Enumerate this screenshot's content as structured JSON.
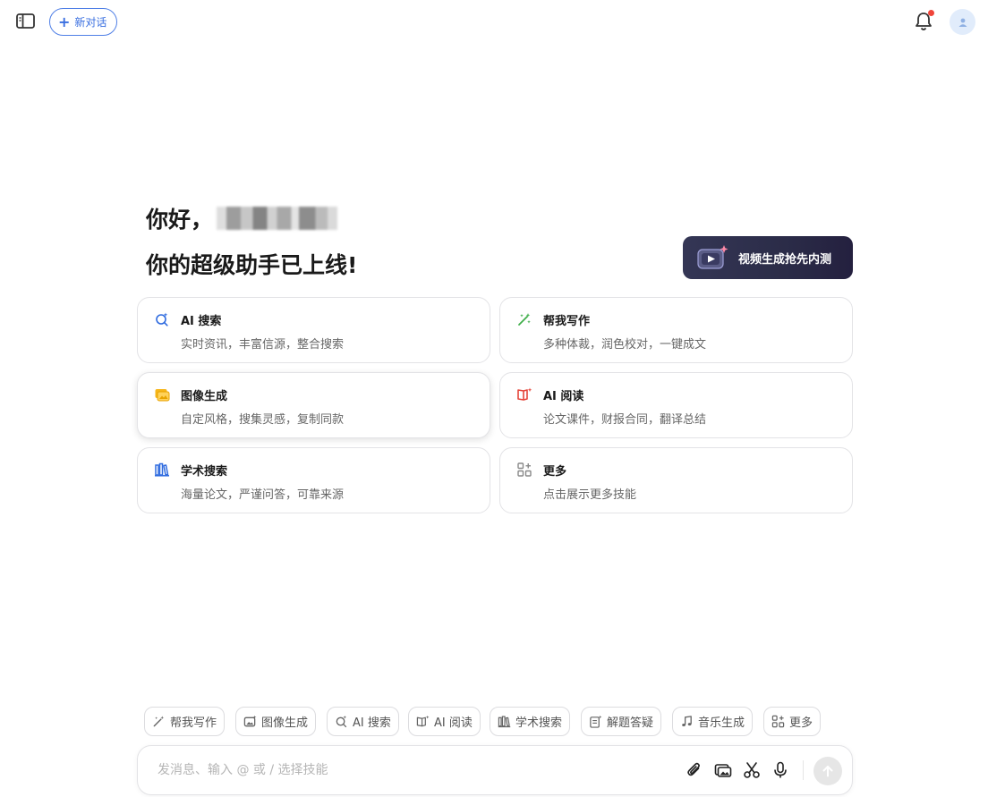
{
  "header": {
    "new_chat_label": "新对话"
  },
  "greeting": {
    "hello": "你好，",
    "subtitle": "你的超级助手已上线!"
  },
  "promo": {
    "label": "视频生成抢先内测"
  },
  "cards": [
    {
      "title": "AI 搜索",
      "desc": "实时资讯，丰富信源，整合搜索",
      "icon": "ai-search-icon"
    },
    {
      "title": "帮我写作",
      "desc": "多种体裁，润色校对，一键成文",
      "icon": "writing-icon"
    },
    {
      "title": "图像生成",
      "desc": "自定风格，搜集灵感，复制同款",
      "icon": "image-gen-icon"
    },
    {
      "title": "AI 阅读",
      "desc": "论文课件，财报合同，翻译总结",
      "icon": "ai-reading-icon"
    },
    {
      "title": "学术搜索",
      "desc": "海量论文，严谨问答，可靠来源",
      "icon": "academic-search-icon"
    },
    {
      "title": "更多",
      "desc": "点击展示更多技能",
      "icon": "more-grid-icon"
    }
  ],
  "chips": [
    {
      "label": "帮我写作"
    },
    {
      "label": "图像生成"
    },
    {
      "label": "AI 搜索"
    },
    {
      "label": "AI 阅读"
    },
    {
      "label": "学术搜索"
    },
    {
      "label": "解题答疑"
    },
    {
      "label": "音乐生成"
    },
    {
      "label": "更多"
    }
  ],
  "input": {
    "placeholder": "发消息、输入 @ 或 / 选择技能"
  },
  "colors": {
    "accent": "#3a6fe0",
    "notification_dot": "#f0453a",
    "promo_bg": "#2b2c48"
  }
}
